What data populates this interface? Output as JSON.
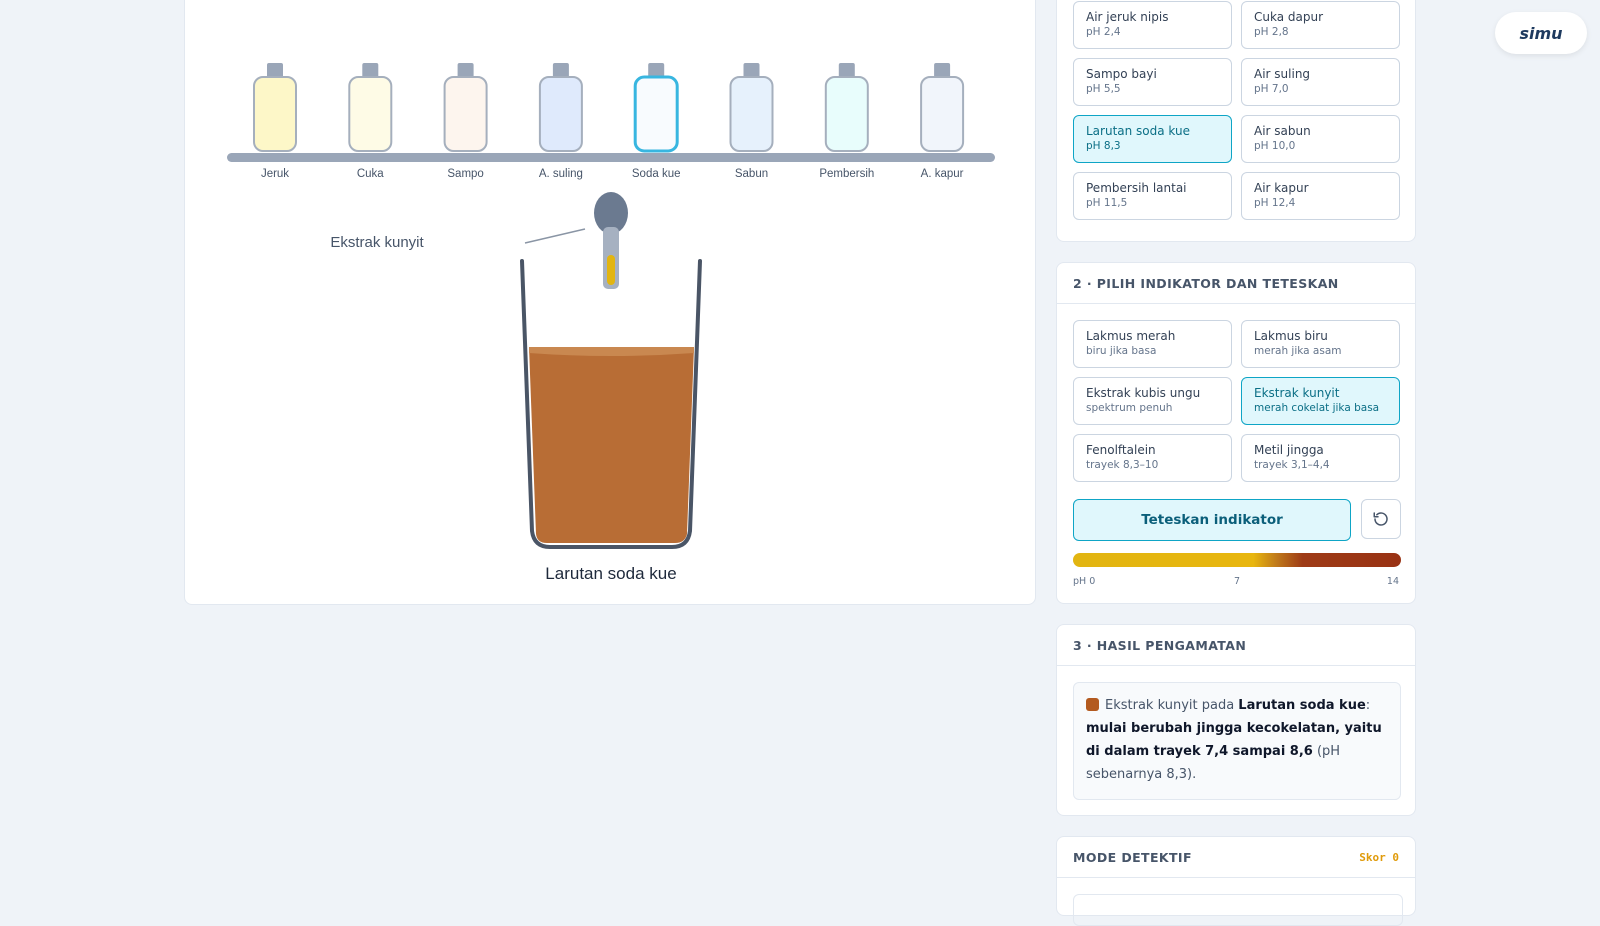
{
  "shelf": {
    "bottles": [
      {
        "label": "Jeruk",
        "fill": "#fdf7c8"
      },
      {
        "label": "Cuka",
        "fill": "#fefbe6"
      },
      {
        "label": "Sampo",
        "fill": "#fdf5ee"
      },
      {
        "label": "A. suling",
        "fill": "#dfeafc"
      },
      {
        "label": "Soda kue",
        "fill": "#f8fbfe"
      },
      {
        "label": "Sabun",
        "fill": "#e6f1fc"
      },
      {
        "label": "Pembersih",
        "fill": "#e8fdfc"
      },
      {
        "label": "A. kapur",
        "fill": "#f1f5fb"
      }
    ],
    "selected_index": 4
  },
  "beaker": {
    "dropper_label": "Ekstrak kunyit",
    "solution_label": "Larutan soda kue",
    "liquid_color": "#b86d35"
  },
  "solutions": [
    {
      "name": "Air jeruk nipis",
      "ph": "pH 2,4"
    },
    {
      "name": "Cuka dapur",
      "ph": "pH 2,8"
    },
    {
      "name": "Sampo bayi",
      "ph": "pH 5,5"
    },
    {
      "name": "Air suling",
      "ph": "pH 7,0"
    },
    {
      "name": "Larutan soda kue",
      "ph": "pH 8,3"
    },
    {
      "name": "Air sabun",
      "ph": "pH 10,0"
    },
    {
      "name": "Pembersih lantai",
      "ph": "pH 11,5"
    },
    {
      "name": "Air kapur",
      "ph": "pH 12,4"
    }
  ],
  "indicator_panel": {
    "title": "2 · PILIH INDIKATOR DAN TETESKAN",
    "options": [
      {
        "name": "Lakmus merah",
        "desc": "biru jika basa"
      },
      {
        "name": "Lakmus biru",
        "desc": "merah jika asam"
      },
      {
        "name": "Ekstrak kubis ungu",
        "desc": "spektrum penuh"
      },
      {
        "name": "Ekstrak kunyit",
        "desc": "merah cokelat jika basa"
      },
      {
        "name": "Fenolftalein",
        "desc": "trayek 8,3–10"
      },
      {
        "name": "Metil jingga",
        "desc": "trayek 3,1–4,4"
      }
    ],
    "drop_button": "Teteskan indikator",
    "scale_labels": [
      "pH 0",
      "7",
      "14"
    ]
  },
  "result_panel": {
    "title": "3 · HASIL PENGAMATAN",
    "indicator": "Ekstrak kunyit",
    "pada": " pada ",
    "solution": "Larutan soda kue",
    "colon": ": ",
    "verdict": "mulai berubah jingga kecokelatan, yaitu di dalam trayek 7,4 sampai 8,6",
    "note": " (pH sebenarnya 8,3)."
  },
  "detective_panel": {
    "title": "MODE DETEKTIF",
    "score": "Skor 0"
  },
  "logo": "simu"
}
